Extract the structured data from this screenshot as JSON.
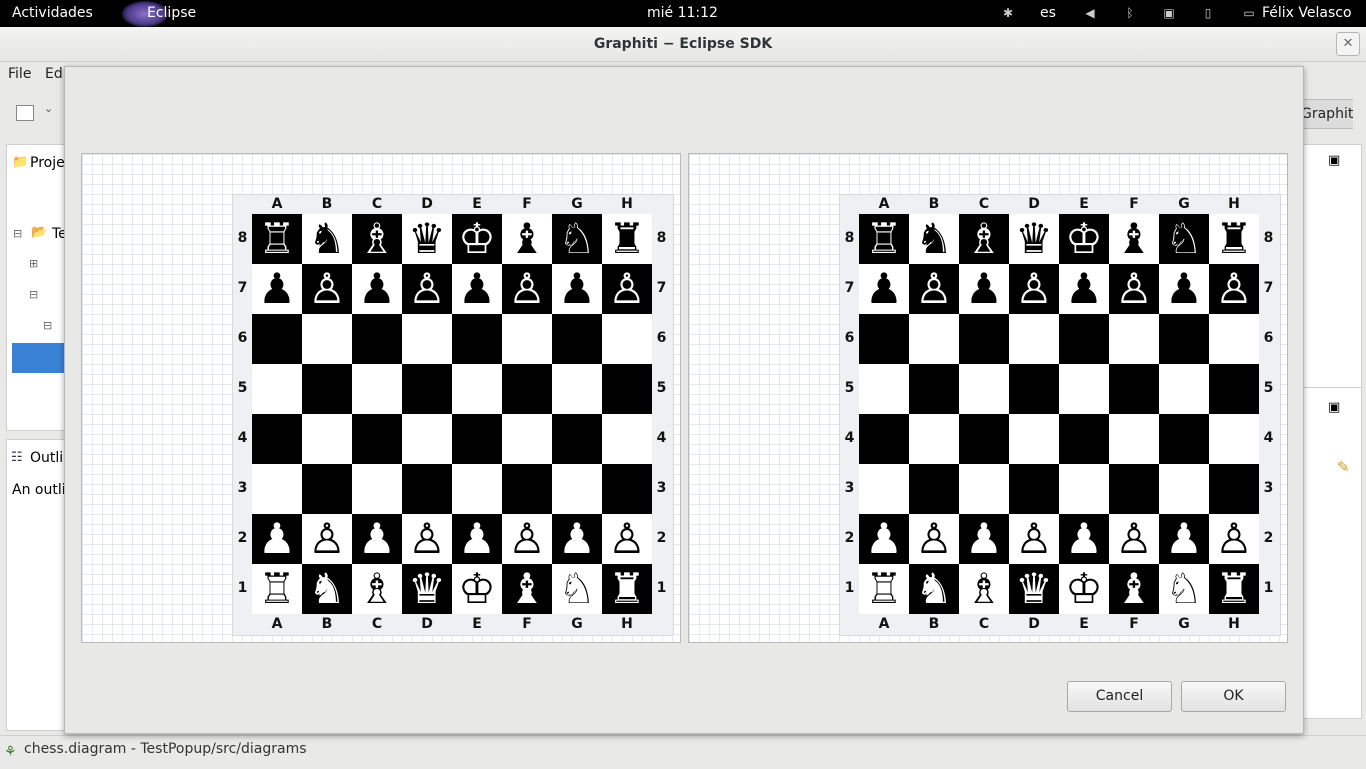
{
  "topbar": {
    "activities": "Actividades",
    "app_name": "Eclipse",
    "clock": "mié 11:12",
    "keyboard_layout": "es",
    "user": "Félix Velasco"
  },
  "window": {
    "title": "Graphiti − Eclipse SDK",
    "menu": [
      "File",
      "Edi"
    ],
    "perspective_tab": "Graphiti"
  },
  "left_panels": {
    "project_title": "Proje",
    "tree_item": "Te",
    "outline_title": "Outli",
    "outline_text": "An outli"
  },
  "statusbar": {
    "path": "chess.diagram - TestPopup/src/diagrams"
  },
  "dialog": {
    "cancel_label": "Cancel",
    "ok_label": "OK"
  },
  "boards": {
    "files": [
      "A",
      "B",
      "C",
      "D",
      "E",
      "F",
      "G",
      "H"
    ],
    "ranks": [
      "8",
      "7",
      "6",
      "5",
      "4",
      "3",
      "2",
      "1"
    ],
    "position": [
      [
        "br",
        "bn",
        "bb",
        "bq",
        "bk",
        "bb",
        "bn",
        "br"
      ],
      [
        "bp",
        "bp",
        "bp",
        "bp",
        "bp",
        "bp",
        "bp",
        "bp"
      ],
      [
        "",
        "",
        "",
        "",
        "",
        "",
        "",
        ""
      ],
      [
        "",
        "",
        "",
        "",
        "",
        "",
        "",
        ""
      ],
      [
        "",
        "",
        "",
        "",
        "",
        "",
        "",
        ""
      ],
      [
        "",
        "",
        "",
        "",
        "",
        "",
        "",
        ""
      ],
      [
        "wp",
        "wp",
        "wp",
        "wp",
        "wp",
        "wp",
        "wp",
        "wp"
      ],
      [
        "wr",
        "wn",
        "wb",
        "wq",
        "wk",
        "wb",
        "wn",
        "wr"
      ]
    ]
  },
  "icons": {
    "accessibility": "accessibility-icon",
    "volume": "volume-muted-icon",
    "bluetooth": "bluetooth-off-icon",
    "network": "network-icon",
    "battery": "battery-icon",
    "chat": "chat-icon"
  }
}
